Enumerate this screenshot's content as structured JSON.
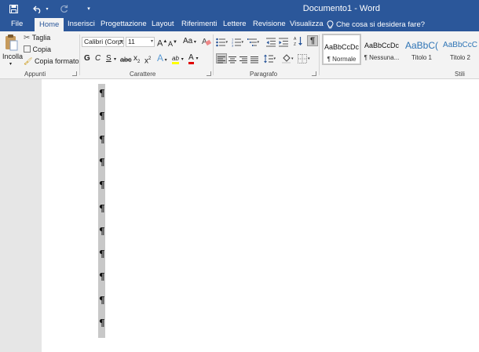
{
  "title_bar": {
    "document_title": "Documento1 - Word",
    "save_icon": "save-icon",
    "undo_icon": "undo-icon",
    "redo_icon": "redo-icon",
    "customize_icon": "customize-qat-icon",
    "colors": {
      "brand": "#2b579a"
    }
  },
  "tabs": [
    {
      "label": "File"
    },
    {
      "label": "Home",
      "active": true
    },
    {
      "label": "Inserisci"
    },
    {
      "label": "Progettazione"
    },
    {
      "label": "Layout"
    },
    {
      "label": "Riferimenti"
    },
    {
      "label": "Lettere"
    },
    {
      "label": "Revisione"
    },
    {
      "label": "Visualizza"
    }
  ],
  "tell_me": {
    "label": "Che cosa si desidera fare?",
    "icon": "lightbulb-icon"
  },
  "clipboard": {
    "paste_label": "Incolla",
    "cut_label": "Taglia",
    "copy_label": "Copia",
    "format_painter_label": "Copia formato",
    "group_label": "Appunti"
  },
  "font": {
    "font_name": "Calibri (Corpo",
    "font_size": "11",
    "grow_label": "A",
    "shrink_label": "A",
    "case_label": "Aa",
    "bold_label": "G",
    "italic_label": "C",
    "underline_label": "S",
    "strike_label": "abc",
    "subscript_label": "x",
    "superscript_label": "x",
    "highlight_label": "ab",
    "font_color_label": "A",
    "group_label": "Carattere"
  },
  "paragraph": {
    "group_label": "Paragrafo",
    "show_marks_label": "¶"
  },
  "styles": {
    "group_label": "Stili",
    "items": [
      {
        "sample": "AaBbCcDc",
        "name": "¶ Normale",
        "selected": true
      },
      {
        "sample": "AaBbCcDc",
        "name": "¶ Nessuna..."
      },
      {
        "sample": "AaBbC(",
        "name": "Titolo 1"
      },
      {
        "sample": "AaBbCcC",
        "name": "Titolo 2"
      }
    ]
  },
  "document": {
    "pilcrow": "¶",
    "paragraph_count": 11
  }
}
